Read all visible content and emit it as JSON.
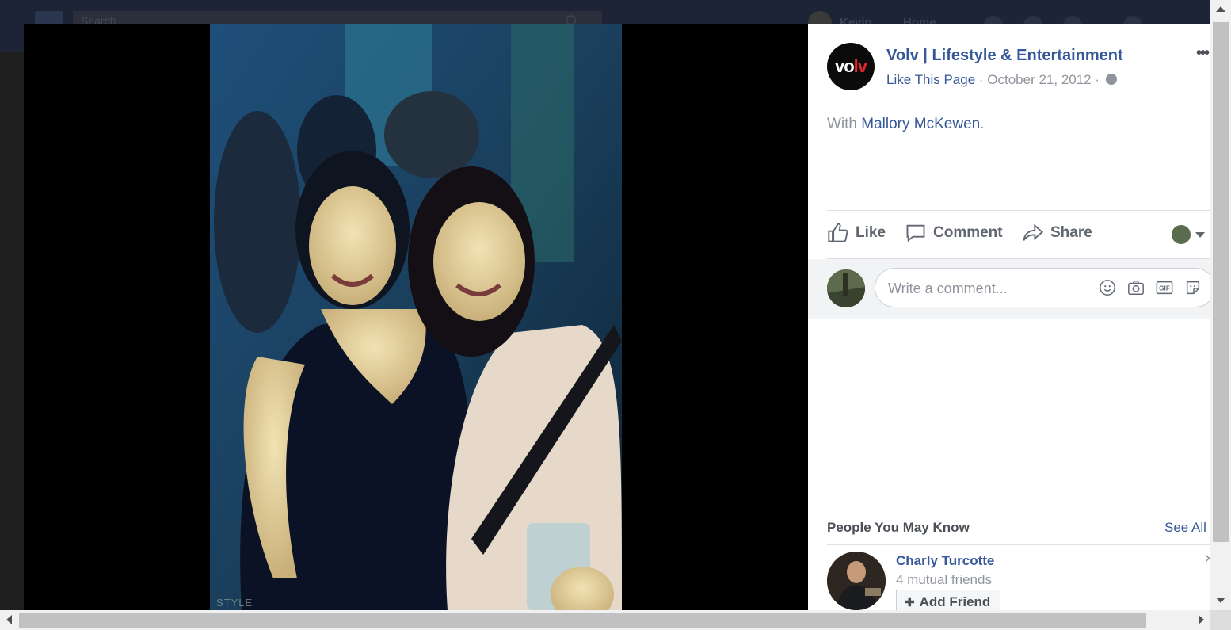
{
  "background": {
    "search_placeholder": "Search",
    "user_name": "Kevin",
    "home_label": "Home"
  },
  "photo": {
    "watermark": "STYLE"
  },
  "post": {
    "page_name": "Volv | Lifestyle & Entertainment",
    "avatar_text": "vo",
    "avatar_text_accent": "lv",
    "like_page": "Like This Page",
    "separator": " · ",
    "date": "October 21, 2012",
    "with_prefix": "With ",
    "tagged_person": "Mallory McKewen",
    "with_suffix": ".",
    "more_icon": "more-horizontal-icon"
  },
  "actions": {
    "like": "Like",
    "comment": "Comment",
    "share": "Share"
  },
  "comment": {
    "placeholder": "Write a comment...",
    "icons": [
      "emoji-icon",
      "camera-icon",
      "gif-icon",
      "sticker-icon"
    ]
  },
  "pymk": {
    "title": "People You May Know",
    "see_all": "See All",
    "people": [
      {
        "name": "Charly Turcotte",
        "mutual": "4 mutual friends",
        "button": "Add Friend"
      }
    ]
  },
  "colors": {
    "link": "#365899",
    "muted": "#90949c",
    "action": "#606770",
    "overlay": "#000000"
  }
}
